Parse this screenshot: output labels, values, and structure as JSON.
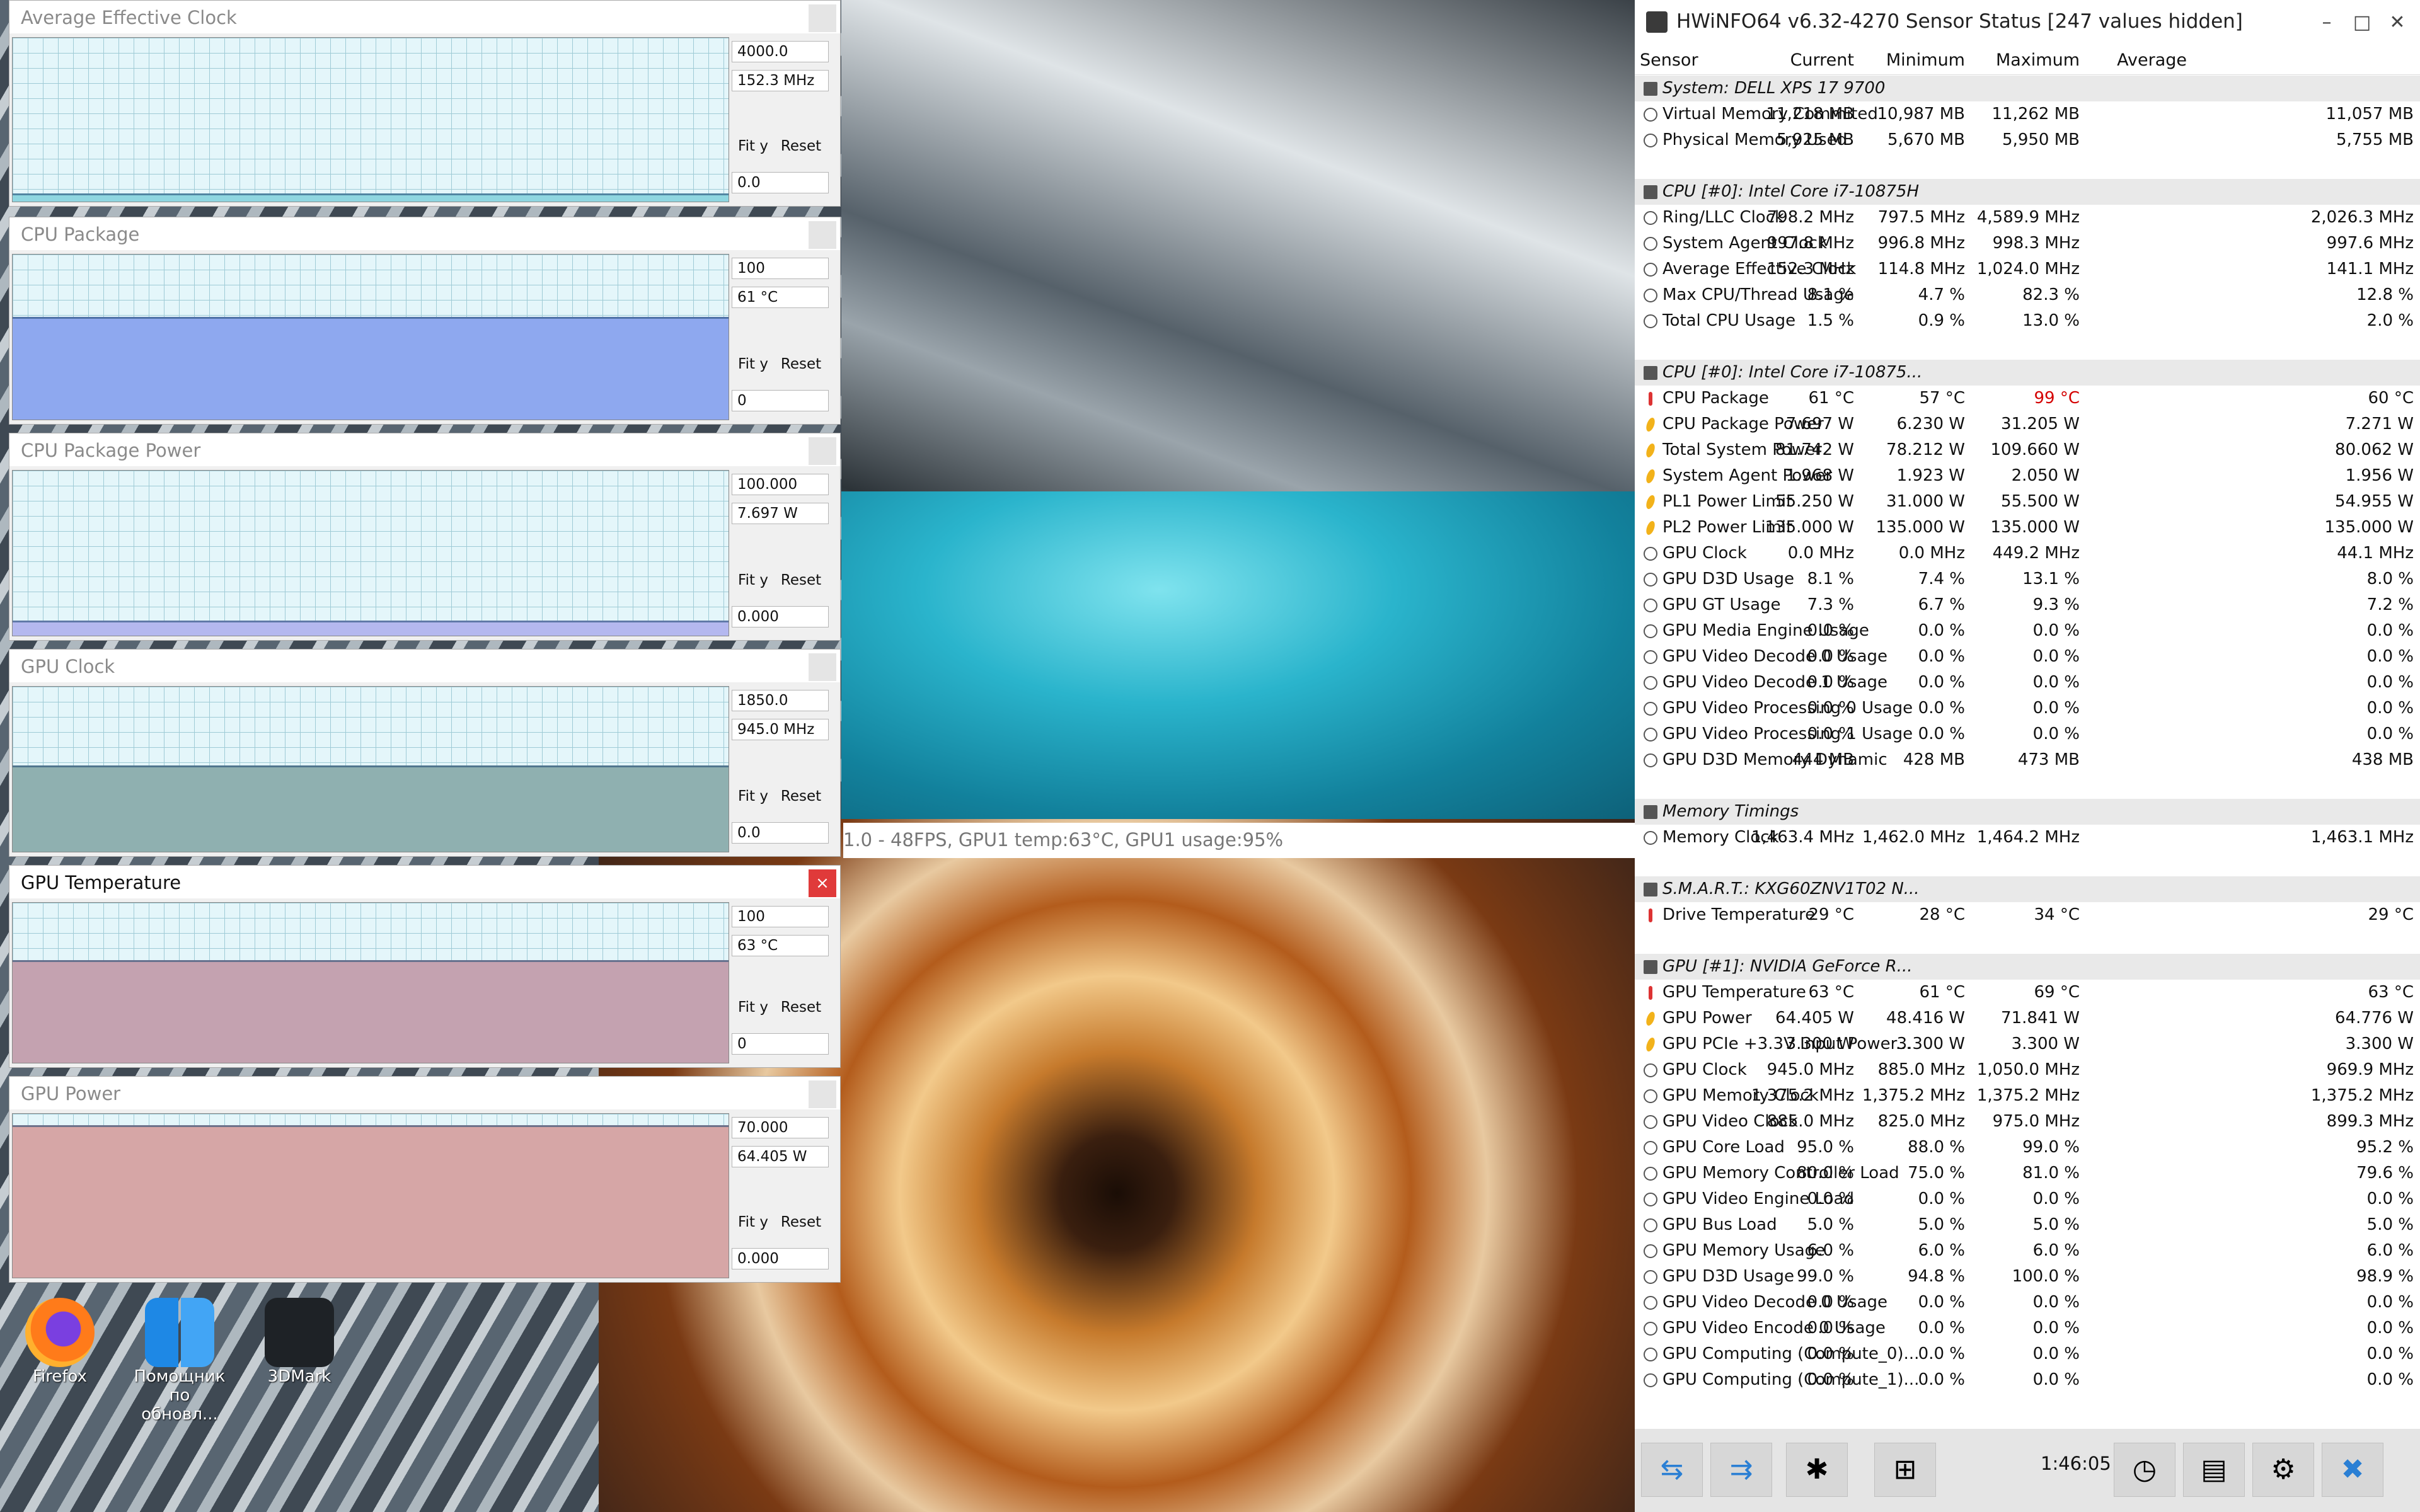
{
  "graphs": [
    {
      "title": "Average Effective Clock",
      "max": "4000.0",
      "current": "152.3 MHz",
      "min": "0.0",
      "fit": "Fit y",
      "reset": "Reset",
      "fill_fraction": 0.04,
      "fill_color": "#8fd6e0"
    },
    {
      "title": "CPU Package",
      "max": "100",
      "current": "61 °C",
      "min": "0",
      "fit": "Fit y",
      "reset": "Reset",
      "fill_fraction": 0.61,
      "fill_color": "#8ea8ef"
    },
    {
      "title": "CPU Package Power",
      "max": "100.000",
      "current": "7.697 W",
      "min": "0.000",
      "fit": "Fit y",
      "reset": "Reset",
      "fill_fraction": 0.08,
      "fill_color": "#b4b8ef"
    },
    {
      "title": "GPU Clock",
      "max": "1850.0",
      "current": "945.0 MHz",
      "min": "0.0",
      "fit": "Fit y",
      "reset": "Reset",
      "fill_fraction": 0.51,
      "fill_color": "#8fb0b0"
    },
    {
      "title": "GPU Temperature",
      "max": "100",
      "current": "63 °C",
      "min": "0",
      "fit": "Fit y",
      "reset": "Reset",
      "fill_fraction": 0.63,
      "fill_color": "#c4a2b0",
      "close": "×"
    },
    {
      "title": "GPU Power",
      "max": "70.000",
      "current": "64.405 W",
      "min": "0.000",
      "fit": "Fit y",
      "reset": "Reset",
      "fill_fraction": 0.92,
      "fill_color": "#d6a6a6"
    }
  ],
  "osd_text": "1.0 - 48FPS, GPU1 temp:63°C, GPU1 usage:95%",
  "desktop_icons": [
    {
      "label": "Firefox"
    },
    {
      "label": "Помощник\nпо обновл..."
    },
    {
      "label": "3DMark"
    }
  ],
  "hwinfo": {
    "title": "HWiNFO64 v6.32-4270 Sensor Status [247 values hidden]",
    "columns": [
      "Sensor",
      "Current",
      "Minimum",
      "Maximum",
      "Average"
    ],
    "rows": [
      {
        "type": "group",
        "name": "System: DELL XPS 17 9700"
      },
      {
        "type": "row",
        "icon": "circle",
        "name": "Virtual Memory Commited",
        "cur": "11,218 MB",
        "min": "10,987 MB",
        "max": "11,262 MB",
        "avg": "11,057 MB"
      },
      {
        "type": "row",
        "icon": "circle",
        "name": "Physical Memory Used",
        "cur": "5,925 MB",
        "min": "5,670 MB",
        "max": "5,950 MB",
        "avg": "5,755 MB"
      },
      {
        "type": "blank"
      },
      {
        "type": "group",
        "name": "CPU [#0]: Intel Core i7-10875H"
      },
      {
        "type": "row",
        "icon": "circle",
        "name": "Ring/LLC Clock",
        "cur": "798.2 MHz",
        "min": "797.5 MHz",
        "max": "4,589.9 MHz",
        "avg": "2,026.3 MHz"
      },
      {
        "type": "row",
        "icon": "circle",
        "name": "System Agent Clock",
        "cur": "997.8 MHz",
        "min": "996.8 MHz",
        "max": "998.3 MHz",
        "avg": "997.6 MHz"
      },
      {
        "type": "row",
        "icon": "circle",
        "name": "Average Effective Clock",
        "cur": "152.3 MHz",
        "min": "114.8 MHz",
        "max": "1,024.0 MHz",
        "avg": "141.1 MHz"
      },
      {
        "type": "row",
        "icon": "circle",
        "name": "Max CPU/Thread Usage",
        "cur": "8.1 %",
        "min": "4.7 %",
        "max": "82.3 %",
        "avg": "12.8 %"
      },
      {
        "type": "row",
        "icon": "circle",
        "name": "Total CPU Usage",
        "cur": "1.5 %",
        "min": "0.9 %",
        "max": "13.0 %",
        "avg": "2.0 %"
      },
      {
        "type": "blank"
      },
      {
        "type": "group",
        "name": "CPU [#0]: Intel Core i7-10875..."
      },
      {
        "type": "row",
        "icon": "temp",
        "name": "CPU Package",
        "cur": "61 °C",
        "min": "57 °C",
        "max": "99 °C",
        "avg": "60 °C",
        "hot": "max"
      },
      {
        "type": "row",
        "icon": "power",
        "name": "CPU Package Power",
        "cur": "7.697 W",
        "min": "6.230 W",
        "max": "31.205 W",
        "avg": "7.271 W"
      },
      {
        "type": "row",
        "icon": "power",
        "name": "Total System Power",
        "cur": "81.742 W",
        "min": "78.212 W",
        "max": "109.660 W",
        "avg": "80.062 W"
      },
      {
        "type": "row",
        "icon": "power",
        "name": "System Agent Power",
        "cur": "1.968 W",
        "min": "1.923 W",
        "max": "2.050 W",
        "avg": "1.956 W"
      },
      {
        "type": "row",
        "icon": "power",
        "name": "PL1 Power Limit",
        "cur": "55.250 W",
        "min": "31.000 W",
        "max": "55.500 W",
        "avg": "54.955 W"
      },
      {
        "type": "row",
        "icon": "power",
        "name": "PL2 Power Limit",
        "cur": "135.000 W",
        "min": "135.000 W",
        "max": "135.000 W",
        "avg": "135.000 W"
      },
      {
        "type": "row",
        "icon": "circle",
        "name": "GPU Clock",
        "cur": "0.0 MHz",
        "min": "0.0 MHz",
        "max": "449.2 MHz",
        "avg": "44.1 MHz"
      },
      {
        "type": "row",
        "icon": "circle",
        "name": "GPU D3D Usage",
        "cur": "8.1 %",
        "min": "7.4 %",
        "max": "13.1 %",
        "avg": "8.0 %"
      },
      {
        "type": "row",
        "icon": "circle",
        "name": "GPU GT Usage",
        "cur": "7.3 %",
        "min": "6.7 %",
        "max": "9.3 %",
        "avg": "7.2 %"
      },
      {
        "type": "row",
        "icon": "circle",
        "name": "GPU Media Engine Usage",
        "cur": "0.0 %",
        "min": "0.0 %",
        "max": "0.0 %",
        "avg": "0.0 %"
      },
      {
        "type": "row",
        "icon": "circle",
        "name": "GPU Video Decode 0 Usage",
        "cur": "0.0 %",
        "min": "0.0 %",
        "max": "0.0 %",
        "avg": "0.0 %"
      },
      {
        "type": "row",
        "icon": "circle",
        "name": "GPU Video Decode 1 Usage",
        "cur": "0.0 %",
        "min": "0.0 %",
        "max": "0.0 %",
        "avg": "0.0 %"
      },
      {
        "type": "row",
        "icon": "circle",
        "name": "GPU Video Processing 0 Usage",
        "cur": "0.0 %",
        "min": "0.0 %",
        "max": "0.0 %",
        "avg": "0.0 %"
      },
      {
        "type": "row",
        "icon": "circle",
        "name": "GPU Video Processing 1 Usage",
        "cur": "0.0 %",
        "min": "0.0 %",
        "max": "0.0 %",
        "avg": "0.0 %"
      },
      {
        "type": "row",
        "icon": "circle",
        "name": "GPU D3D Memory Dynamic",
        "cur": "444 MB",
        "min": "428 MB",
        "max": "473 MB",
        "avg": "438 MB"
      },
      {
        "type": "blank"
      },
      {
        "type": "group",
        "name": "Memory Timings"
      },
      {
        "type": "row",
        "icon": "circle",
        "name": "Memory Clock",
        "cur": "1,463.4 MHz",
        "min": "1,462.0 MHz",
        "max": "1,464.2 MHz",
        "avg": "1,463.1 MHz"
      },
      {
        "type": "blank"
      },
      {
        "type": "group",
        "name": "S.M.A.R.T.: KXG60ZNV1T02 N..."
      },
      {
        "type": "row",
        "icon": "temp",
        "name": "Drive Temperature",
        "cur": "29 °C",
        "min": "28 °C",
        "max": "34 °C",
        "avg": "29 °C"
      },
      {
        "type": "blank"
      },
      {
        "type": "group",
        "name": "GPU [#1]: NVIDIA GeForce R..."
      },
      {
        "type": "row",
        "icon": "temp",
        "name": "GPU Temperature",
        "cur": "63 °C",
        "min": "61 °C",
        "max": "69 °C",
        "avg": "63 °C"
      },
      {
        "type": "row",
        "icon": "power",
        "name": "GPU Power",
        "cur": "64.405 W",
        "min": "48.416 W",
        "max": "71.841 W",
        "avg": "64.776 W"
      },
      {
        "type": "row",
        "icon": "power",
        "name": "GPU PCIe +3.3V Input Power...",
        "cur": "3.300 W",
        "min": "3.300 W",
        "max": "3.300 W",
        "avg": "3.300 W"
      },
      {
        "type": "row",
        "icon": "circle",
        "name": "GPU Clock",
        "cur": "945.0 MHz",
        "min": "885.0 MHz",
        "max": "1,050.0 MHz",
        "avg": "969.9 MHz"
      },
      {
        "type": "row",
        "icon": "circle",
        "name": "GPU Memory Clock",
        "cur": "1,375.2 MHz",
        "min": "1,375.2 MHz",
        "max": "1,375.2 MHz",
        "avg": "1,375.2 MHz"
      },
      {
        "type": "row",
        "icon": "circle",
        "name": "GPU Video Clock",
        "cur": "885.0 MHz",
        "min": "825.0 MHz",
        "max": "975.0 MHz",
        "avg": "899.3 MHz"
      },
      {
        "type": "row",
        "icon": "circle",
        "name": "GPU Core Load",
        "cur": "95.0 %",
        "min": "88.0 %",
        "max": "99.0 %",
        "avg": "95.2 %"
      },
      {
        "type": "row",
        "icon": "circle",
        "name": "GPU Memory Controller Load",
        "cur": "80.0 %",
        "min": "75.0 %",
        "max": "81.0 %",
        "avg": "79.6 %"
      },
      {
        "type": "row",
        "icon": "circle",
        "name": "GPU Video Engine Load",
        "cur": "0.0 %",
        "min": "0.0 %",
        "max": "0.0 %",
        "avg": "0.0 %"
      },
      {
        "type": "row",
        "icon": "circle",
        "name": "GPU Bus Load",
        "cur": "5.0 %",
        "min": "5.0 %",
        "max": "5.0 %",
        "avg": "5.0 %"
      },
      {
        "type": "row",
        "icon": "circle",
        "name": "GPU Memory Usage",
        "cur": "6.0 %",
        "min": "6.0 %",
        "max": "6.0 %",
        "avg": "6.0 %"
      },
      {
        "type": "row",
        "icon": "circle",
        "name": "GPU D3D Usage",
        "cur": "99.0 %",
        "min": "94.8 %",
        "max": "100.0 %",
        "avg": "98.9 %"
      },
      {
        "type": "row",
        "icon": "circle",
        "name": "GPU Video Decode 0 Usage",
        "cur": "0.0 %",
        "min": "0.0 %",
        "max": "0.0 %",
        "avg": "0.0 %"
      },
      {
        "type": "row",
        "icon": "circle",
        "name": "GPU Video Encode 0 Usage",
        "cur": "0.0 %",
        "min": "0.0 %",
        "max": "0.0 %",
        "avg": "0.0 %"
      },
      {
        "type": "row",
        "icon": "circle",
        "name": "GPU Computing (Compute_0)...",
        "cur": "0.0 %",
        "min": "0.0 %",
        "max": "0.0 %",
        "avg": "0.0 %"
      },
      {
        "type": "row",
        "icon": "circle",
        "name": "GPU Computing (Compute_1)...",
        "cur": "0.0 %",
        "min": "0.0 %",
        "max": "0.0 %",
        "avg": "0.0 %"
      }
    ],
    "clock": "1:46:05",
    "footer_buttons": [
      "nav-left-right-icon",
      "nav-collapse-icon",
      "fan-icon",
      "network-icon",
      "clock-icon",
      "report-add-icon",
      "settings-gear-icon",
      "close-x-icon"
    ]
  }
}
